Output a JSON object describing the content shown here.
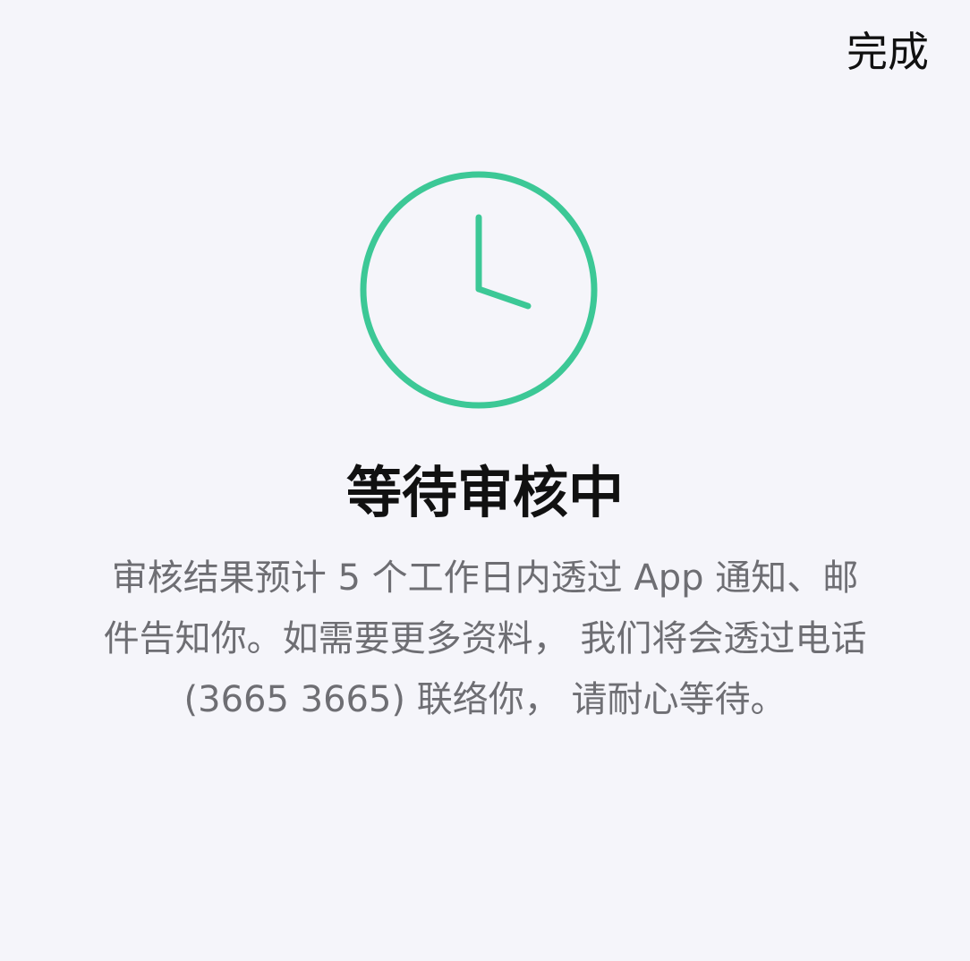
{
  "header": {
    "done_label": "完成"
  },
  "status": {
    "icon": "clock-icon",
    "title": "等待审核中",
    "description": "审核结果预计 5 个工作日内透过 App 通知、邮件告知你。如需要更多资料， 我们将会透过电话 (3665 3665) 联络你， 请耐心等待。"
  },
  "colors": {
    "accent": "#3cc896",
    "background": "#f5f5fa",
    "title": "#111111",
    "description": "#6e6e73"
  }
}
